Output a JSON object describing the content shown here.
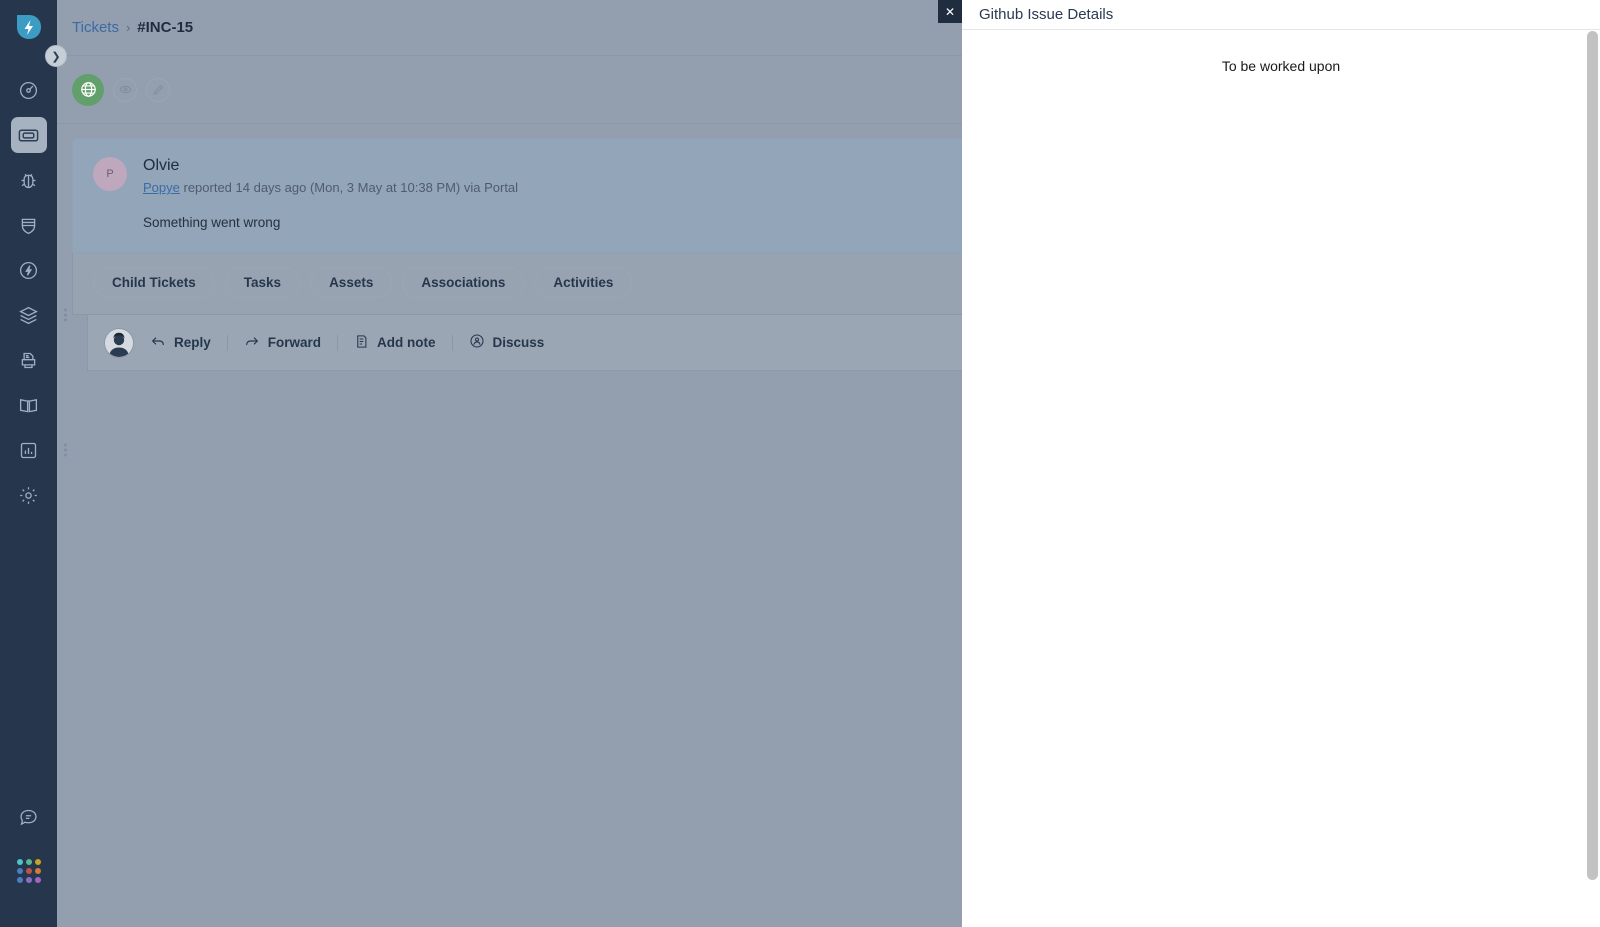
{
  "product": {
    "logo_icon": "lightning-droplet-logo"
  },
  "sidebar": {
    "items": [
      {
        "label": "Dashboard",
        "icon": "gauge-icon",
        "active": false,
        "has_menu": false
      },
      {
        "label": "Tickets",
        "icon": "ticket-icon",
        "active": true,
        "has_menu": false
      },
      {
        "label": "Problems",
        "icon": "bug-icon",
        "active": false,
        "has_menu": false
      },
      {
        "label": "Changes",
        "icon": "shield-icon",
        "active": false,
        "has_menu": false
      },
      {
        "label": "Releases",
        "icon": "flash-circle-icon",
        "active": false,
        "has_menu": false
      },
      {
        "label": "Assets",
        "icon": "layers-icon",
        "active": false,
        "has_menu": true
      },
      {
        "label": "Purchase Orders",
        "icon": "purchase-order-icon",
        "active": false,
        "has_menu": false
      },
      {
        "label": "Solutions",
        "icon": "book-icon",
        "active": false,
        "has_menu": false
      },
      {
        "label": "Analytics",
        "icon": "bar-chart-icon",
        "active": false,
        "has_menu": true
      },
      {
        "label": "Admin",
        "icon": "gear-icon",
        "active": false,
        "has_menu": false
      }
    ],
    "bottom_items": [
      {
        "label": "Chat",
        "icon": "chat-bubble-icon"
      },
      {
        "label": "Switch product",
        "icon": "app-grid-icon"
      }
    ],
    "app_grid_colors": [
      "#4fc3c7",
      "#57b894",
      "#c9a227",
      "#4a7fc1",
      "#c2524a",
      "#d4793a",
      "#4a7fc1",
      "#8a6fc1",
      "#a463c6"
    ],
    "collapse_icon": "chevron-right-icon",
    "background_color": "#26374d"
  },
  "breadcrumb": {
    "parent": "Tickets",
    "separator": "›",
    "current": "#INC-15"
  },
  "toolbar": {
    "channel_icon": "globe-icon",
    "channel_color": "#61a06b",
    "watch_icon": "eye-icon",
    "edit_icon": "pencil-icon"
  },
  "ticket": {
    "requester_name": "Olvie",
    "avatar_initial": "P",
    "meta_author": "Popye",
    "meta_rest": " reported 14 days ago (Mon, 3 May at 10:38 PM) via Portal",
    "body": "Something went wrong",
    "tabs": [
      {
        "label": "Child Tickets"
      },
      {
        "label": "Tasks"
      },
      {
        "label": "Assets"
      },
      {
        "label": "Associations"
      },
      {
        "label": "Activities"
      }
    ]
  },
  "reply_bar": {
    "actions": [
      {
        "label": "Reply",
        "icon": "reply-arrow-icon"
      },
      {
        "label": "Forward",
        "icon": "forward-arrow-icon"
      },
      {
        "label": "Add note",
        "icon": "note-document-icon"
      },
      {
        "label": "Discuss",
        "icon": "discuss-person-icon"
      }
    ]
  },
  "side_panel": {
    "title": "Github Issue Details",
    "message": "To be worked upon",
    "close_icon": "close-icon",
    "close_label": "✕"
  }
}
